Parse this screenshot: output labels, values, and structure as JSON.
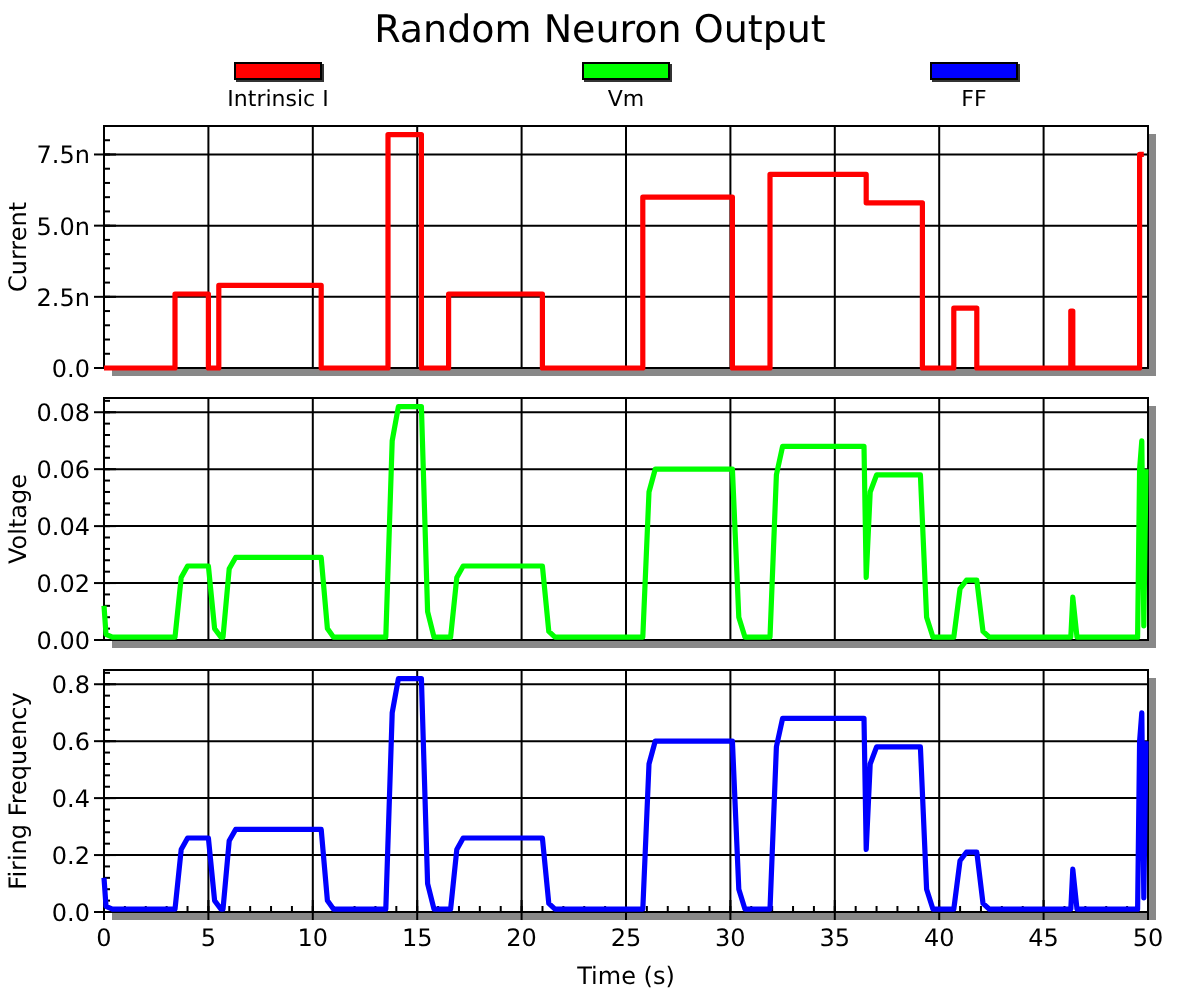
{
  "title": "Random Neuron Output",
  "charts": [
    {
      "chart_data": {
        "type": "line",
        "grid": true,
        "ylabel": "Current",
        "xlim": [
          0,
          50
        ],
        "ylim": [
          0,
          8.5
        ],
        "yticks": [
          {
            "value": 0,
            "label": "0.0"
          },
          {
            "value": 2.5,
            "label": "2.5n"
          },
          {
            "value": 5,
            "label": "5.0n"
          },
          {
            "value": 7.5,
            "label": "7.5n"
          }
        ],
        "x": [
          0,
          3.4,
          3.4,
          5.0,
          5.0,
          5.5,
          5.5,
          10.4,
          10.4,
          13.6,
          13.6,
          15.2,
          15.2,
          16.5,
          16.5,
          21.0,
          21.0,
          25.8,
          25.8,
          30.1,
          30.1,
          31.9,
          31.9,
          36.5,
          36.5,
          39.2,
          39.2,
          40.7,
          40.7,
          41.8,
          41.8,
          46.3,
          46.3,
          46.4,
          46.4,
          49.6,
          49.6,
          49.8
        ],
        "series": [
          {
            "name": "Intrinsic I",
            "color": "#ff0000",
            "values": [
              0,
              0,
              2.6,
              2.6,
              0,
              0,
              2.9,
              2.9,
              0,
              0,
              8.2,
              8.2,
              0,
              0,
              2.6,
              2.6,
              0,
              0,
              6.0,
              6.0,
              0,
              0,
              6.8,
              6.8,
              5.8,
              5.8,
              0,
              0,
              2.1,
              2.1,
              0,
              0,
              2.0,
              2.0,
              0,
              0,
              7.5,
              7.5
            ]
          }
        ]
      }
    },
    {
      "chart_data": {
        "type": "line",
        "grid": true,
        "ylabel": "Voltage",
        "xlim": [
          0,
          50
        ],
        "ylim": [
          0,
          0.085
        ],
        "yticks": [
          {
            "value": 0,
            "label": "0.00"
          },
          {
            "value": 0.02,
            "label": "0.02"
          },
          {
            "value": 0.04,
            "label": "0.04"
          },
          {
            "value": 0.06,
            "label": "0.06"
          },
          {
            "value": 0.08,
            "label": "0.08"
          }
        ],
        "x": [
          0,
          0.1,
          0.4,
          3.4,
          3.7,
          4.0,
          5.0,
          5.3,
          5.6,
          5.7,
          6.0,
          6.3,
          10.4,
          10.7,
          11.0,
          13.5,
          13.8,
          14.1,
          15.2,
          15.5,
          15.8,
          16.6,
          16.9,
          17.2,
          21.0,
          21.3,
          21.6,
          25.8,
          26.1,
          26.4,
          30.1,
          30.4,
          30.7,
          31.9,
          32.2,
          32.5,
          36.4,
          36.5,
          36.7,
          37.0,
          39.1,
          39.4,
          39.7,
          40.7,
          41.0,
          41.3,
          41.8,
          42.1,
          42.4,
          46.3,
          46.4,
          46.6,
          49.5,
          49.6,
          49.7,
          49.8,
          49.9
        ],
        "series": [
          {
            "name": "Vm",
            "color": "#00ff00",
            "values": [
              0.012,
              0.002,
              0.001,
              0.001,
              0.022,
              0.026,
              0.026,
              0.004,
              0.001,
              0.001,
              0.025,
              0.029,
              0.029,
              0.004,
              0.001,
              0.001,
              0.07,
              0.082,
              0.082,
              0.01,
              0.001,
              0.001,
              0.022,
              0.026,
              0.026,
              0.003,
              0.001,
              0.001,
              0.052,
              0.06,
              0.06,
              0.008,
              0.001,
              0.001,
              0.058,
              0.068,
              0.068,
              0.022,
              0.052,
              0.058,
              0.058,
              0.008,
              0.001,
              0.001,
              0.018,
              0.021,
              0.021,
              0.003,
              0.001,
              0.001,
              0.015,
              0.001,
              0.001,
              0.06,
              0.07,
              0.005,
              0.06
            ]
          }
        ]
      }
    },
    {
      "chart_data": {
        "type": "line",
        "grid": true,
        "ylabel": "Firing Frequency",
        "xlabel": "Time (s)",
        "xlim": [
          0,
          50
        ],
        "ylim": [
          0,
          0.85
        ],
        "xticks": [
          0,
          5,
          10,
          15,
          20,
          25,
          30,
          35,
          40,
          45,
          50
        ],
        "yticks": [
          {
            "value": 0,
            "label": "0.0"
          },
          {
            "value": 0.2,
            "label": "0.2"
          },
          {
            "value": 0.4,
            "label": "0.4"
          },
          {
            "value": 0.6,
            "label": "0.6"
          },
          {
            "value": 0.8,
            "label": "0.8"
          }
        ],
        "x": [
          0,
          0.1,
          0.4,
          3.4,
          3.7,
          4.0,
          5.0,
          5.3,
          5.6,
          5.7,
          6.0,
          6.3,
          10.4,
          10.7,
          11.0,
          13.5,
          13.8,
          14.1,
          15.2,
          15.5,
          15.8,
          16.6,
          16.9,
          17.2,
          21.0,
          21.3,
          21.6,
          25.8,
          26.1,
          26.4,
          30.1,
          30.4,
          30.7,
          31.9,
          32.2,
          32.5,
          36.4,
          36.5,
          36.7,
          37.0,
          39.1,
          39.4,
          39.7,
          40.7,
          41.0,
          41.3,
          41.8,
          42.1,
          42.4,
          46.3,
          46.4,
          46.6,
          49.5,
          49.6,
          49.7,
          49.8,
          49.9
        ],
        "series": [
          {
            "name": "FF",
            "color": "#0000ff",
            "values": [
              0.12,
              0.02,
              0.01,
              0.01,
              0.22,
              0.26,
              0.26,
              0.04,
              0.01,
              0.01,
              0.25,
              0.29,
              0.29,
              0.04,
              0.01,
              0.01,
              0.7,
              0.82,
              0.82,
              0.1,
              0.01,
              0.01,
              0.22,
              0.26,
              0.26,
              0.03,
              0.01,
              0.01,
              0.52,
              0.6,
              0.6,
              0.08,
              0.01,
              0.01,
              0.58,
              0.68,
              0.68,
              0.22,
              0.52,
              0.58,
              0.58,
              0.08,
              0.01,
              0.01,
              0.18,
              0.21,
              0.21,
              0.03,
              0.01,
              0.01,
              0.15,
              0.01,
              0.01,
              0.6,
              0.7,
              0.05,
              0.6
            ]
          }
        ]
      }
    }
  ]
}
